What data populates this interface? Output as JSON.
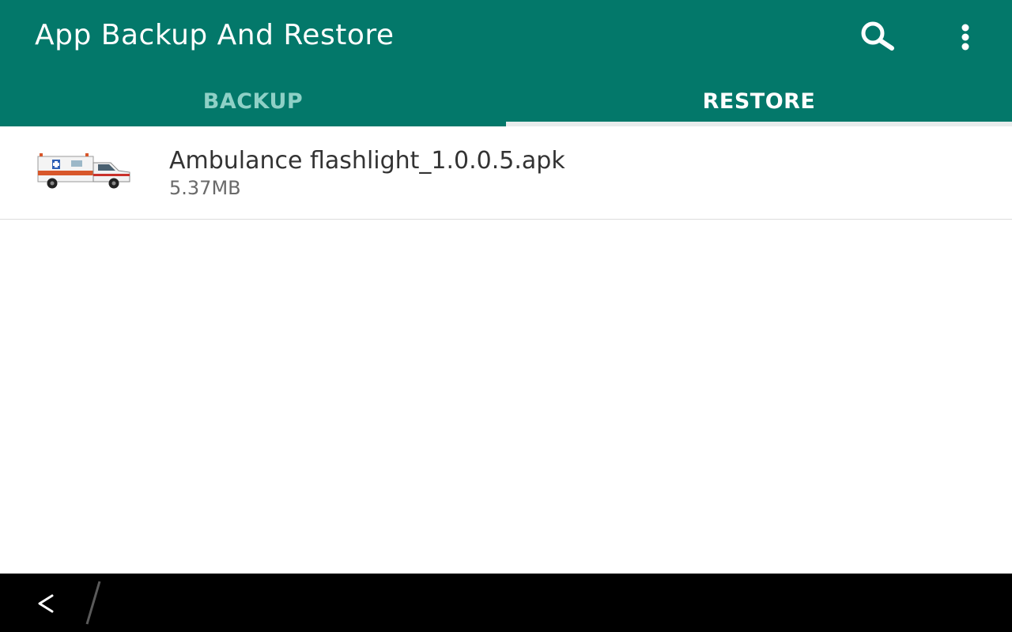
{
  "app_bar": {
    "title": "App Backup And Restore",
    "background_color": "#03786a",
    "actions": [
      {
        "icon": "search-icon"
      },
      {
        "icon": "more-vert-icon"
      }
    ]
  },
  "tabs": [
    {
      "label": "BACKUP",
      "selected": false
    },
    {
      "label": "RESTORE",
      "selected": true
    }
  ],
  "restore_list": {
    "items": [
      {
        "thumbnail_icon": "ambulance-icon",
        "name": "Ambulance flashlight_1.0.0.5.apk",
        "size": "5.37MB"
      }
    ]
  },
  "navigation_bar": {
    "back_icon": "back-arrow-icon"
  }
}
